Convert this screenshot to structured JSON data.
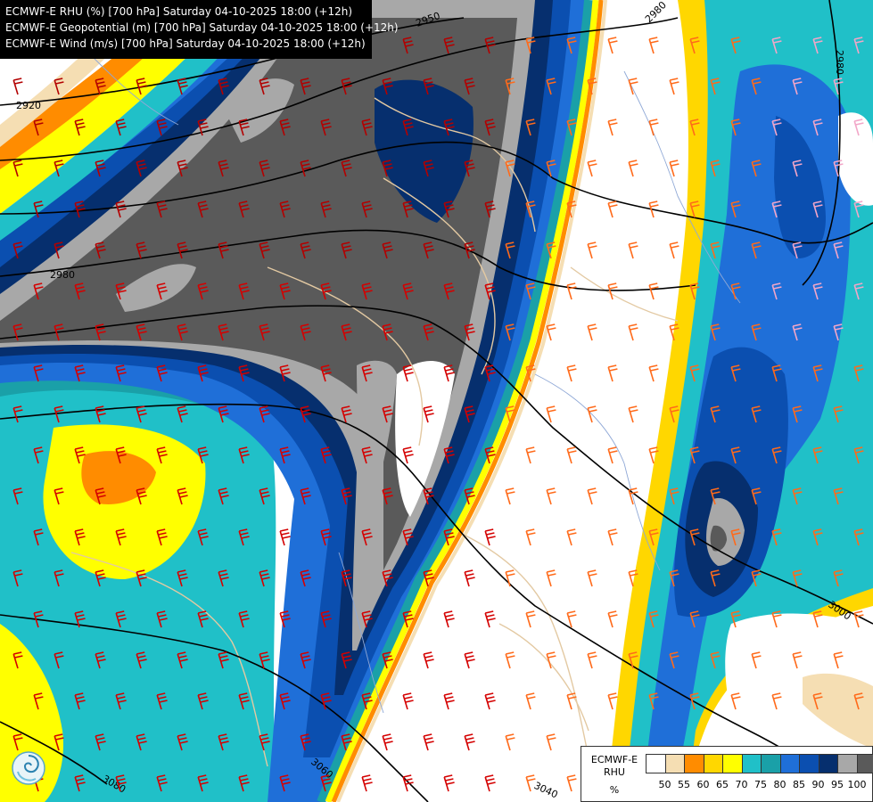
{
  "titles": [
    "ECMWF-E RHU (%) [700 hPa] Saturday 04-10-2025 18:00 (+12h)",
    "ECMWF-E Geopotential (m) [700 hPa] Saturday 04-10-2025 18:00 (+12h)",
    "ECMWF-E Wind (m/s) [700 hPa] Saturday 04-10-2025 18:00 (+12h)"
  ],
  "legend": {
    "name_line1": "ECMWF-E",
    "name_line2": "RHU",
    "unit": "%",
    "ticks": [
      "50",
      "55",
      "60",
      "65",
      "70",
      "75",
      "80",
      "85",
      "90",
      "95",
      "100"
    ],
    "colors": [
      "#ffffff",
      "#f5deb3",
      "#ff8c00",
      "#ffd700",
      "#ffff00",
      "#20c0c8",
      "#1aa0a8",
      "#1f6fd8",
      "#0b4fb0",
      "#062f6e",
      "#a8a8a8",
      "#5a5a5a"
    ]
  },
  "contours": [
    {
      "label": "2920"
    },
    {
      "label": "2950"
    },
    {
      "label": "2980"
    },
    {
      "label": "2980"
    },
    {
      "label": "2980"
    },
    {
      "label": "3000"
    },
    {
      "label": "3040"
    },
    {
      "label": "3060"
    },
    {
      "label": "3080"
    }
  ],
  "logo_icon": "ecmwf-swirl-logo-icon"
}
